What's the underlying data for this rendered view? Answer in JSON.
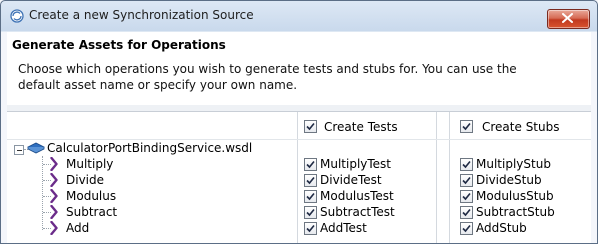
{
  "window": {
    "title": "Create a new Synchronization Source",
    "icon": "sync-globe-icon",
    "close_icon": "close-icon"
  },
  "header": {
    "title": "Generate Assets for Operations",
    "description": "Choose which operations you wish to generate tests and stubs for. You can use the default asset name or specify your own name."
  },
  "columns": {
    "tests": {
      "label": "Create Tests",
      "checked": true
    },
    "stubs": {
      "label": "Create Stubs",
      "checked": true
    }
  },
  "tree": {
    "root": {
      "label": "CalculatorPortBindingService.wsdl",
      "expanded": true,
      "icon": "wsdl-book-icon"
    },
    "operations": [
      {
        "name": "Multiply",
        "test": "MultiplyTest",
        "stub": "MultiplyStub",
        "test_checked": true,
        "stub_checked": true
      },
      {
        "name": "Divide",
        "test": "DivideTest",
        "stub": "DivideStub",
        "test_checked": true,
        "stub_checked": true
      },
      {
        "name": "Modulus",
        "test": "ModulusTest",
        "stub": "ModulusStub",
        "test_checked": true,
        "stub_checked": true
      },
      {
        "name": "Subtract",
        "test": "SubtractTest",
        "stub": "SubtractStub",
        "test_checked": true,
        "stub_checked": true
      },
      {
        "name": "Add",
        "test": "AddTest",
        "stub": "AddStub",
        "test_checked": true,
        "stub_checked": true
      }
    ]
  },
  "colors": {
    "operation_icon": "#6b2c8a",
    "titlebar": "#c9d9ec",
    "close": "#c1391f"
  }
}
